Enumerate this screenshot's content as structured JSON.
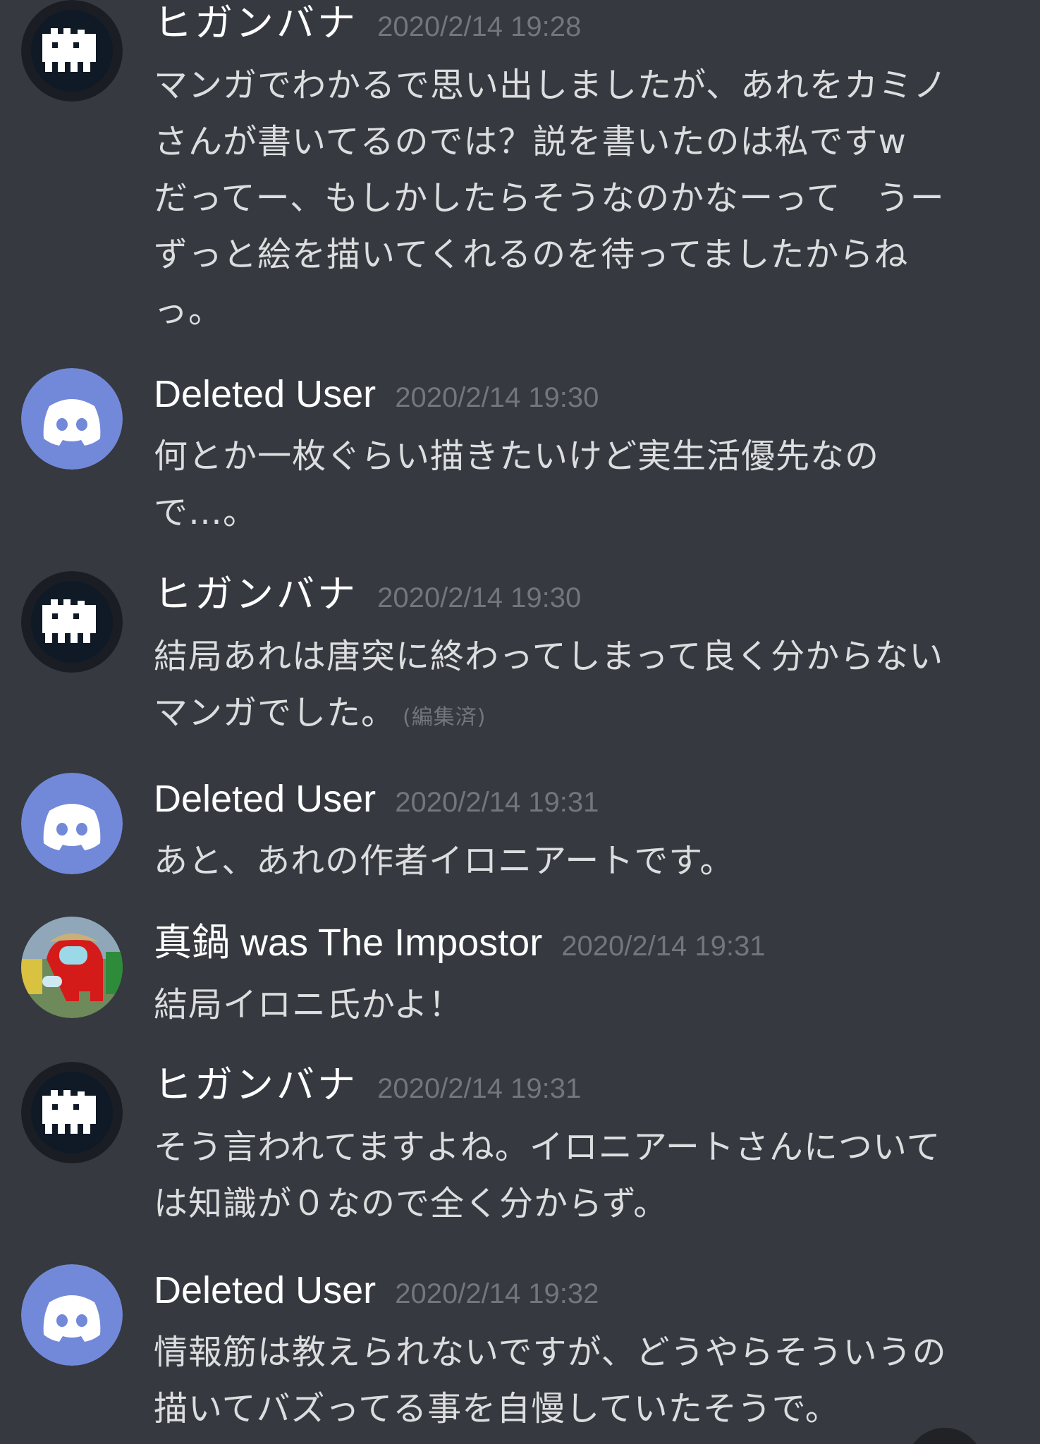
{
  "messages": [
    {
      "author": "ヒガンバナ",
      "timestamp": "2020/2/14 19:28",
      "lines": [
        "マンガでわかるで思い出しましたが、あれをカミノ",
        "さんが書いてるのでは？説を書いたのは私ですw",
        "だってー、もしかしたらそうなのかなーって　うー",
        "ずっと絵を描いてくれるのを待ってましたからね",
        "っ。"
      ]
    },
    {
      "author": "Deleted User",
      "timestamp": "2020/2/14 19:30",
      "lines": [
        "何とか一枚ぐらい描きたいけど実生活優先なの",
        "で…。"
      ]
    },
    {
      "author": "ヒガンバナ",
      "timestamp": "2020/2/14 19:30",
      "lines": [
        "結局あれは唐突に終わってしまって良く分からない",
        "マンガでした。"
      ],
      "edited_label": "(編集済)"
    },
    {
      "author": "Deleted User",
      "timestamp": "2020/2/14 19:31",
      "lines": [
        "あと、あれの作者イロニアートです。"
      ]
    },
    {
      "author": "真鍋 was The Impostor",
      "timestamp": "2020/2/14 19:31",
      "lines": [
        "結局イロニ氏かよ！"
      ]
    },
    {
      "author": "ヒガンバナ",
      "timestamp": "2020/2/14 19:31",
      "lines": [
        "そう言われてますよね。イロニアートさんについて",
        "は知識が０なので全く分からず。"
      ]
    },
    {
      "author": "Deleted User",
      "timestamp": "2020/2/14 19:32",
      "lines": [
        "情報筋は教えられないですが、どうやらそういうの",
        "描いてバズってる事を自慢していたそうで。"
      ]
    }
  ],
  "icons": {
    "higanbana_avatar": "pixel-creature-avatar-icon",
    "deleted_user_avatar": "discord-logo-avatar-icon",
    "manabe_avatar": "red-crewmate-avatar-icon"
  },
  "colors": {
    "background": "#36393f",
    "username": "#ffffff",
    "timestamp": "#72767d",
    "message_text": "#dcddde",
    "discord_blurple": "#7289da"
  }
}
